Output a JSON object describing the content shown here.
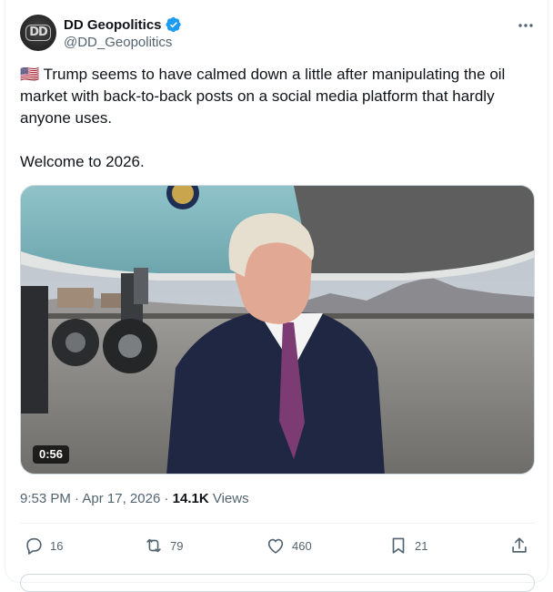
{
  "author": {
    "name": "DD Geopolitics",
    "handle": "@DD_Geopolitics",
    "avatar_text": "DD"
  },
  "tweet": {
    "flag": "🇺🇸",
    "text": " Trump seems to have calmed down a little after manipulating the oil market with back-to-back posts on a social media platform that hardly anyone uses.\n\nWelcome to 2026."
  },
  "media": {
    "duration": "0:56"
  },
  "meta": {
    "time": "9:53 PM",
    "date": "Apr 17, 2026",
    "views_count": "14.1K",
    "views_label": "Views",
    "separator": " · "
  },
  "actions": {
    "replies": "16",
    "reposts": "79",
    "likes": "460",
    "bookmarks": "21"
  },
  "colors": {
    "accent": "#1d9bf0",
    "secondary_text": "#536471",
    "primary_text": "#0f1419"
  }
}
